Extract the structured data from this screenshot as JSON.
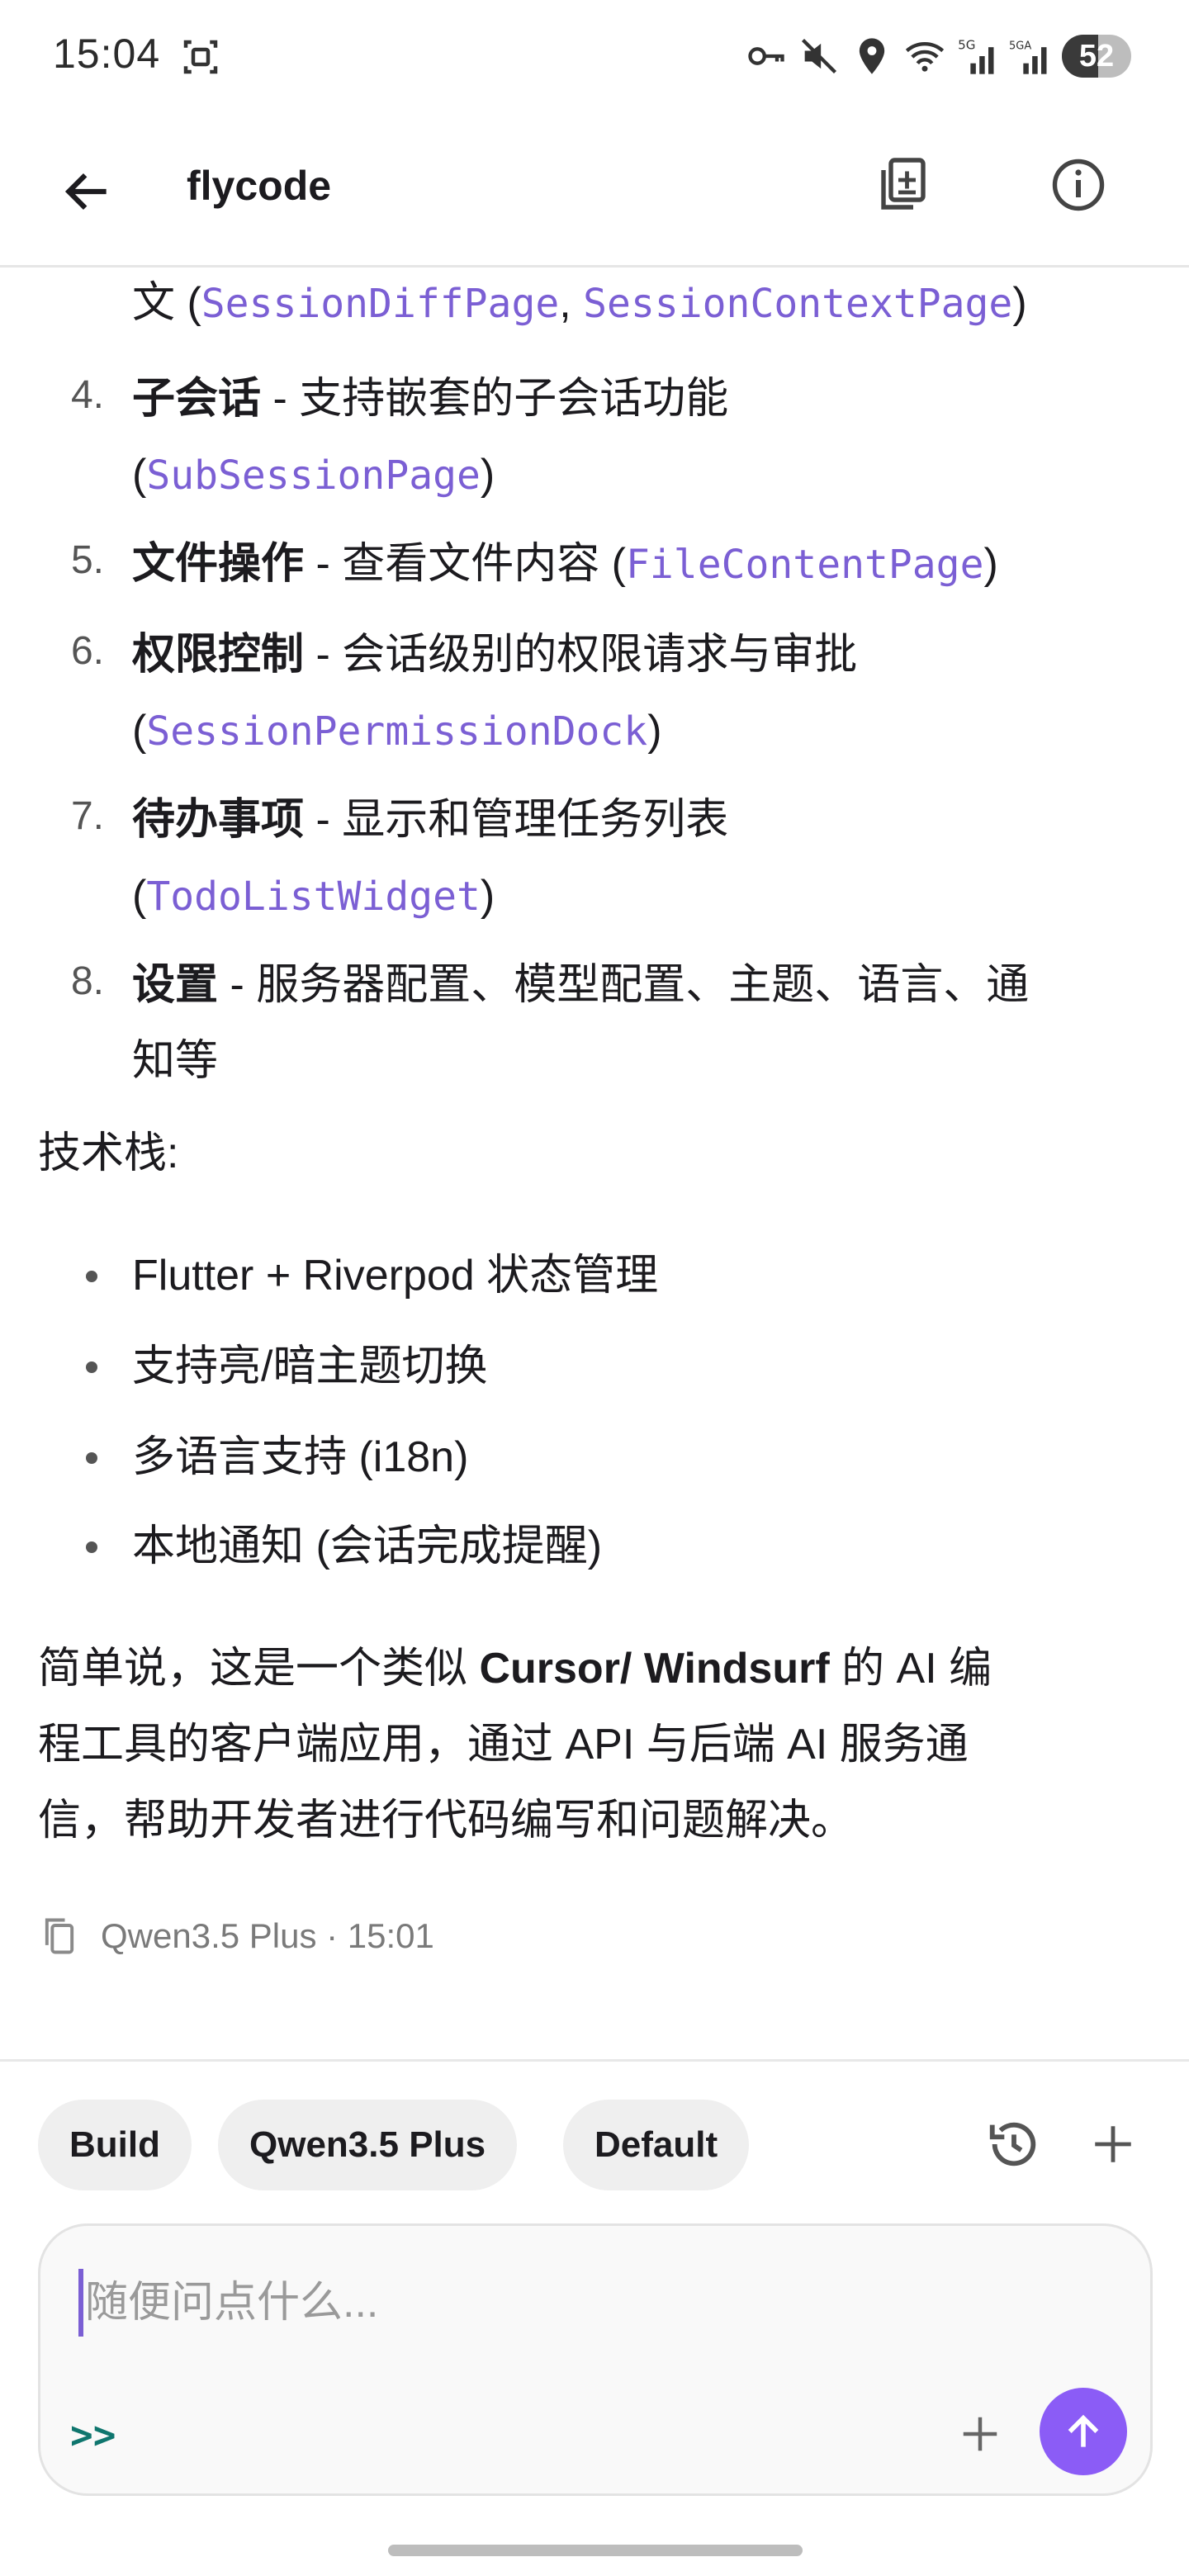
{
  "status_bar": {
    "time": "15:04",
    "icons": [
      "screenshot-icon",
      "vpn-key-icon",
      "mute-icon",
      "location-icon",
      "wifi-icon",
      "signal-5g-icon",
      "signal-5ga-icon"
    ],
    "battery_level": "52",
    "battery_fraction": 0.52
  },
  "app_bar": {
    "title": "flycode",
    "back_icon": "arrow-back-icon",
    "actions": [
      "copy-document-icon",
      "info-icon"
    ]
  },
  "message": {
    "ordered_list": [
      {
        "number": "",
        "bold": "",
        "text": "文 (",
        "codes": [
          "SessionDiffPage",
          "SessionContextPage"
        ],
        "sep": ", ",
        "tail": ")"
      },
      {
        "number": "4.",
        "bold": "子会话",
        "text": " - 支持嵌套的子会话功能",
        "line2_prefix": "(",
        "code": "SubSessionPage",
        "tail": ")"
      },
      {
        "number": "5.",
        "bold": "文件操作",
        "text": " - 查看文件内容 (",
        "code": "FileContentPage",
        "tail": ")"
      },
      {
        "number": "6.",
        "bold": "权限控制",
        "text": " - 会话级别的权限请求与审批",
        "line2_prefix": "(",
        "code": "SessionPermissionDock",
        "tail": ")"
      },
      {
        "number": "7.",
        "bold": "待办事项",
        "text": " - 显示和管理任务列表",
        "line2_prefix": "(",
        "code": "TodoListWidget",
        "tail": ")"
      },
      {
        "number": "8.",
        "bold": "设置",
        "text": " - 服务器配置、模型配置、主题、语言、通",
        "line2": "知等"
      }
    ],
    "tech_stack_heading": "技术栈:",
    "tech_stack": [
      "Flutter + Riverpod 状态管理",
      "支持亮/暗主题切换",
      "多语言支持 (i18n)",
      "本地通知 (会话完成提醒)"
    ],
    "summary": {
      "line1_pre": "简单说，这是一个类似 ",
      "line1_bold": "Cursor/ Windsurf",
      "line1_post": " 的 AI 编",
      "line2": "程工具的客户端应用，通过 API 与后端 AI 服务通",
      "line3": "信，帮助开发者进行代码编写和问题解决。"
    },
    "meta": "Qwen3.5 Plus · 15:01"
  },
  "composer": {
    "chips": [
      "Build",
      "Qwen3.5 Plus",
      "Default"
    ],
    "placeholder": "随便问点什么...",
    "mode_indicator": ">>",
    "colors": {
      "accent": "#8b5cf6",
      "code": "#7b5fd4",
      "mode": "#0f766e"
    }
  }
}
